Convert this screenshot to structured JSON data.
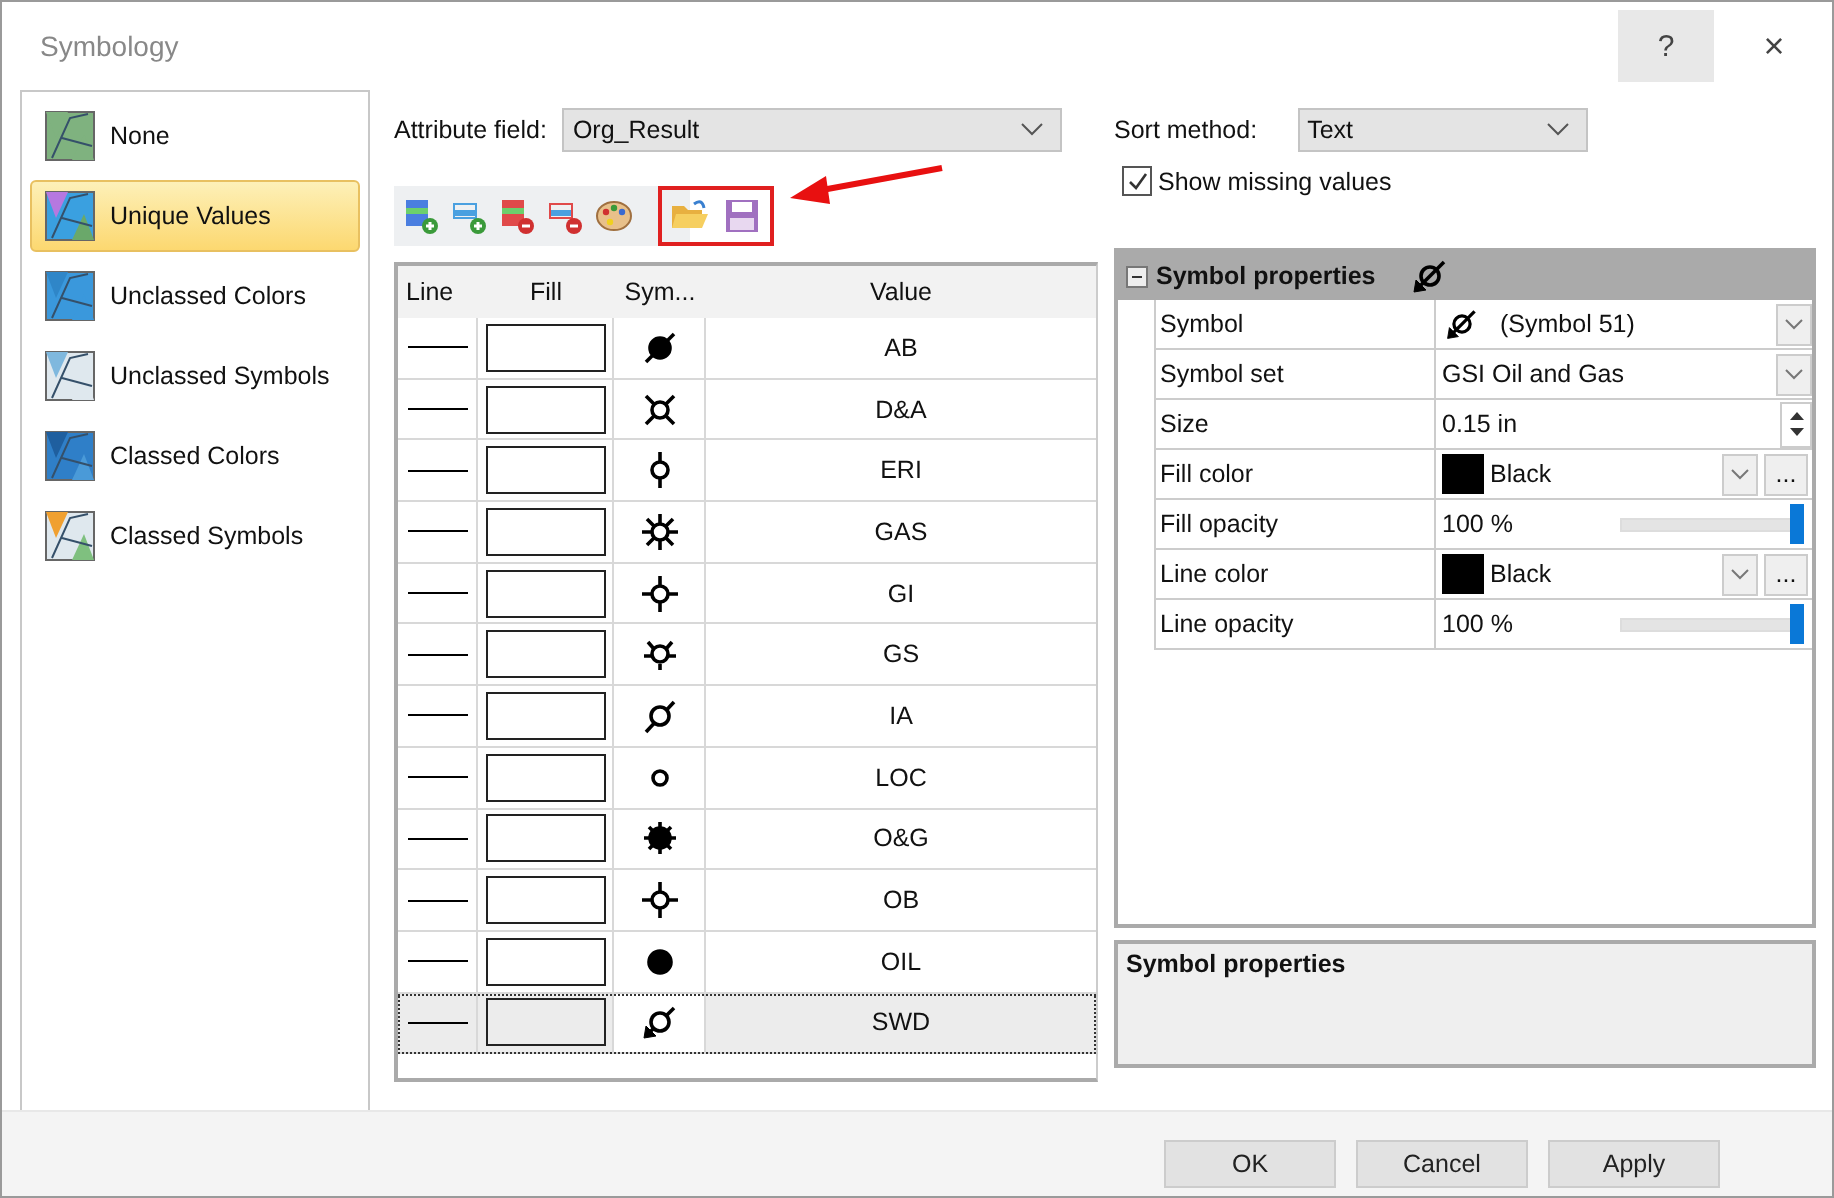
{
  "window": {
    "title": "Symbology",
    "help": "?",
    "close": "×"
  },
  "sidebar": {
    "items": [
      {
        "label": "None",
        "selected": false
      },
      {
        "label": "Unique Values",
        "selected": true
      },
      {
        "label": "Unclassed Colors",
        "selected": false
      },
      {
        "label": "Unclassed Symbols",
        "selected": false
      },
      {
        "label": "Classed Colors",
        "selected": false
      },
      {
        "label": "Classed Symbols",
        "selected": false
      }
    ]
  },
  "attribute_field": {
    "label": "Attribute field:",
    "value": "Org_Result"
  },
  "sort_method": {
    "label": "Sort method:",
    "value": "Text"
  },
  "show_missing_values": {
    "label": "Show missing values",
    "checked": true
  },
  "table": {
    "columns": [
      "Line",
      "Fill",
      "Sym...",
      "Value"
    ],
    "rows": [
      {
        "symbol": {
          "kind": "filled-slash"
        },
        "value": "AB",
        "selected": false
      },
      {
        "symbol": {
          "kind": "crossed-circle"
        },
        "value": "D&A",
        "selected": false
      },
      {
        "symbol": {
          "kind": "circle-vertical"
        },
        "value": "ERI",
        "selected": false
      },
      {
        "symbol": {
          "kind": "sun"
        },
        "value": "GAS",
        "selected": false
      },
      {
        "symbol": {
          "kind": "circle-cross"
        },
        "value": "GI",
        "selected": false
      },
      {
        "symbol": {
          "kind": "circle-spokes"
        },
        "value": "GS",
        "selected": false
      },
      {
        "symbol": {
          "kind": "circle-slash"
        },
        "value": "IA",
        "selected": false
      },
      {
        "symbol": {
          "kind": "circle"
        },
        "value": "LOC",
        "selected": false
      },
      {
        "symbol": {
          "kind": "filled-sun"
        },
        "value": "O&G",
        "selected": false
      },
      {
        "symbol": {
          "kind": "circle-cross"
        },
        "value": "OB",
        "selected": false
      },
      {
        "symbol": {
          "kind": "filled"
        },
        "value": "OIL",
        "selected": false
      },
      {
        "symbol": {
          "kind": "circle-slash-arrow"
        },
        "value": "SWD",
        "selected": true
      }
    ]
  },
  "properties": {
    "title": "Symbol properties",
    "symbol": {
      "kind": "circle-slash-arrow"
    },
    "expanded": true,
    "rows": [
      {
        "kind": "symbol",
        "label": "Symbol",
        "value": "(Symbol 51)",
        "symbol": {
          "kind": "circle-slash-arrow"
        }
      },
      {
        "kind": "dropdown",
        "label": "Symbol set",
        "value": "GSI Oil and Gas"
      },
      {
        "kind": "spin",
        "label": "Size",
        "value": "0.15 in"
      },
      {
        "kind": "color",
        "label": "Fill color",
        "value": "Black",
        "color": "#000000",
        "more": "..."
      },
      {
        "kind": "slider",
        "label": "Fill opacity",
        "value": "100 %",
        "level": 1
      },
      {
        "kind": "color",
        "label": "Line color",
        "value": "Black",
        "color": "#000000",
        "more": "..."
      },
      {
        "kind": "slider",
        "label": "Line opacity",
        "value": "100 %",
        "level": 1
      }
    ]
  },
  "description": {
    "title": "Symbol properties"
  },
  "buttons": [
    "OK",
    "Cancel",
    "Apply"
  ]
}
